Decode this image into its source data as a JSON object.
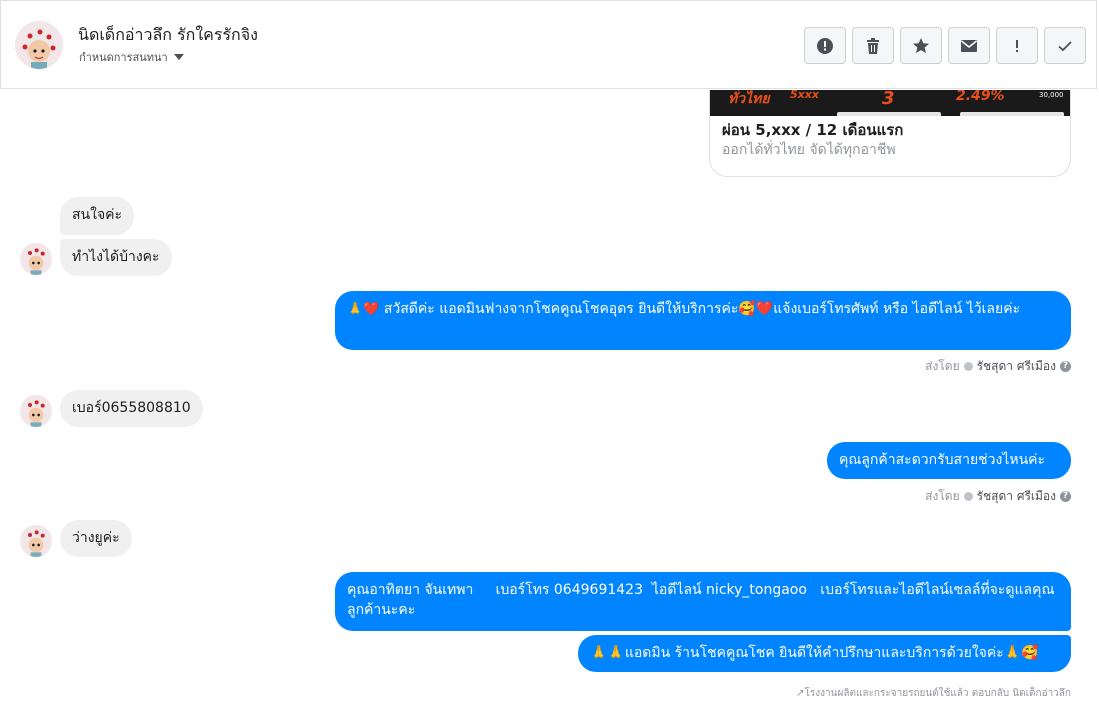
{
  "header": {
    "title": "นิดเด็กอ่าวลึก รักใครรักจิง",
    "assign_label": "กำหนดการสนทนา"
  },
  "card": {
    "image_texts": [
      "ทั่วไทย",
      "5xxx",
      "3",
      "2.49%",
      "30,000"
    ],
    "title": "ผ่อน 5,xxx / 12 เดือนแรก",
    "subtitle": "ออกได้ทั่วไทย จัดได้ทุกอาชีพ"
  },
  "messages": [
    {
      "text": "สนใจค่ะ"
    },
    {
      "text": "ทำไงได้บ้างคะ"
    },
    {
      "emoji": "🙏❤️",
      "text": "สวัสดีค่ะ แอดมินฟางจากโชคคูณโชคอุดร ยินดีให้บริการค่ะ🥰❤️แจ้งเบอร์โทรศัพท์ หรือ ไอดีไลน์  ไว้เลยค่ะ"
    },
    {
      "text": "เบอร์0655808810"
    },
    {
      "text": "คุณลูกค้าสะดวกรับสายช่วงไหนค่ะ"
    },
    {
      "text": "ว่างยูค่ะ"
    },
    {
      "text": "คุณอาทิตยา จันเทพา     เบอร์โทร 0649691423  ไอดีไลน์ nicky_tongaoo   เบอร์โทรและไอดีไลน์เซลล์ที่จะดูแลคุณลูกค้านะคะ"
    },
    {
      "text": "🙏🙏แอดมิน ร้านโชคคูณโชค ยินดีให้คำปรึกษาและบริการด้วยใจค่ะ🙏🥰"
    }
  ],
  "sent_by": {
    "prefix": "ส่งโดย",
    "name": "รัชสุดา ศรีเมือง",
    "help": "?"
  },
  "footer": "↗โรงงานผลิตและกระจายรถยนต์ใช้แล้ว ตอบกลับ นิดเด็กอ่าวลึก",
  "colors": {
    "outgoing": "#0084ff",
    "incoming": "#f1f0f0"
  }
}
